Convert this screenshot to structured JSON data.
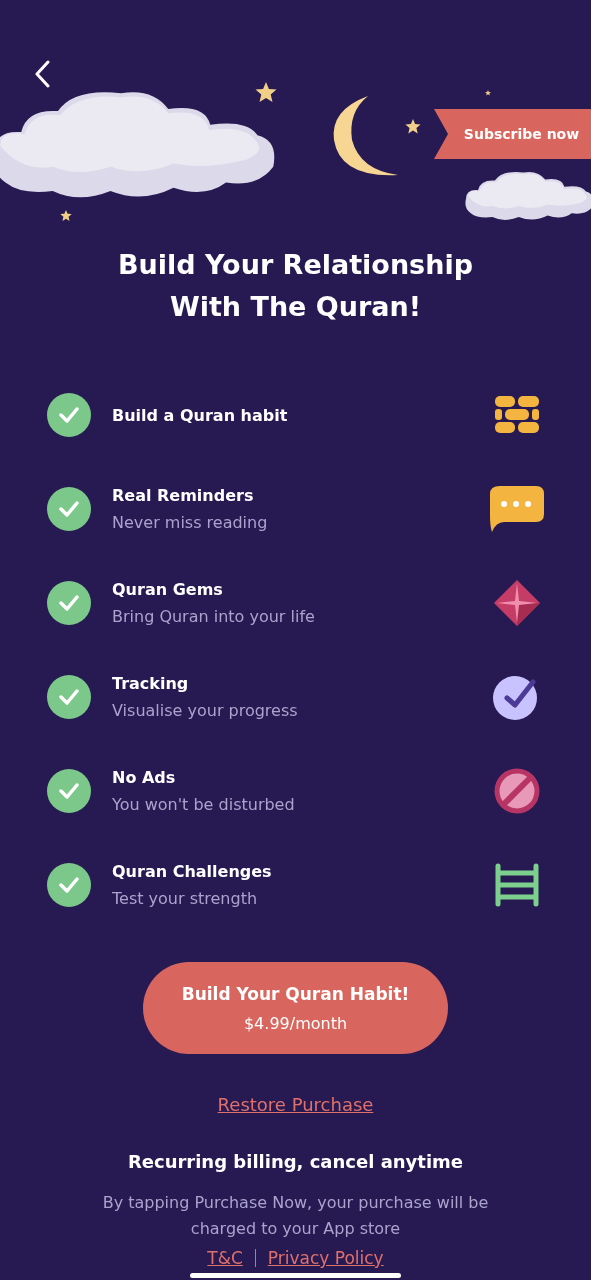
{
  "header": {
    "ribbon": "Subscribe now"
  },
  "title": "Build Your Relationship With The Quran!",
  "features": [
    {
      "title": "Build a Quran habit",
      "checked": true,
      "kind": "bricks"
    },
    {
      "title": "Real Reminders",
      "subtitle": "Never miss reading",
      "checked": true,
      "kind": "chat"
    },
    {
      "title": "Quran Gems",
      "subtitle": "Bring Quran into your life",
      "checked": true,
      "kind": "gem"
    },
    {
      "title": "Tracking",
      "subtitle": "Visualise your progress",
      "checked": true,
      "kind": "check"
    },
    {
      "title": "No Ads",
      "subtitle": "You won't be disturbed",
      "checked": true,
      "kind": "noads"
    },
    {
      "title": "Quran Challenges",
      "subtitle": "Test your strength",
      "checked": true,
      "kind": "ladder"
    }
  ],
  "cta": {
    "label": "Build Your Quran Habit!",
    "price": "$4.99/month"
  },
  "restore": "Restore Purchase",
  "billing": "Recurring billing, cancel anytime",
  "disclaimer": "By tapping Purchase Now, your purchase will be charged to your App store",
  "links": [
    "T&C",
    "Privacy Policy"
  ]
}
